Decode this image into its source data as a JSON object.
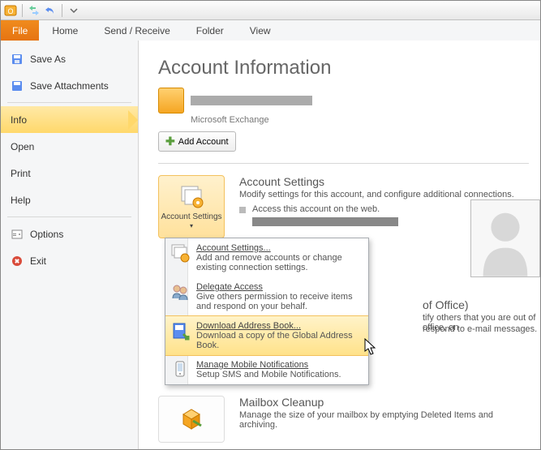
{
  "ribbon": {
    "file": "File",
    "tabs": [
      "Home",
      "Send / Receive",
      "Folder",
      "View"
    ]
  },
  "sidebar": {
    "save_as": "Save As",
    "save_attachments": "Save Attachments",
    "info": "Info",
    "open": "Open",
    "print": "Print",
    "help": "Help",
    "options": "Options",
    "exit": "Exit"
  },
  "page": {
    "title": "Account Information",
    "account_type": "Microsoft Exchange",
    "add_account": "Add Account"
  },
  "section_settings": {
    "button": "Account Settings",
    "title": "Account Settings",
    "desc": "Modify settings for this account, and configure additional connections.",
    "bullet": "Access this account on the web."
  },
  "section_autoreply": {
    "title_suffix": "of Office)",
    "desc1": "tify others that you are out of office, on",
    "desc2": "respond to e-mail messages."
  },
  "section_cleanup": {
    "title": "Mailbox Cleanup",
    "desc": "Manage the size of your mailbox by emptying Deleted Items and archiving."
  },
  "dropdown": {
    "items": [
      {
        "title": "Account Settings...",
        "desc": "Add and remove accounts or change existing connection settings."
      },
      {
        "title": "Delegate Access",
        "desc": "Give others permission to receive items and respond on your behalf."
      },
      {
        "title": "Download Address Book...",
        "desc": "Download a copy of the Global Address Book."
      },
      {
        "title": "Manage Mobile Notifications",
        "desc": "Setup SMS and Mobile Notifications."
      }
    ]
  }
}
